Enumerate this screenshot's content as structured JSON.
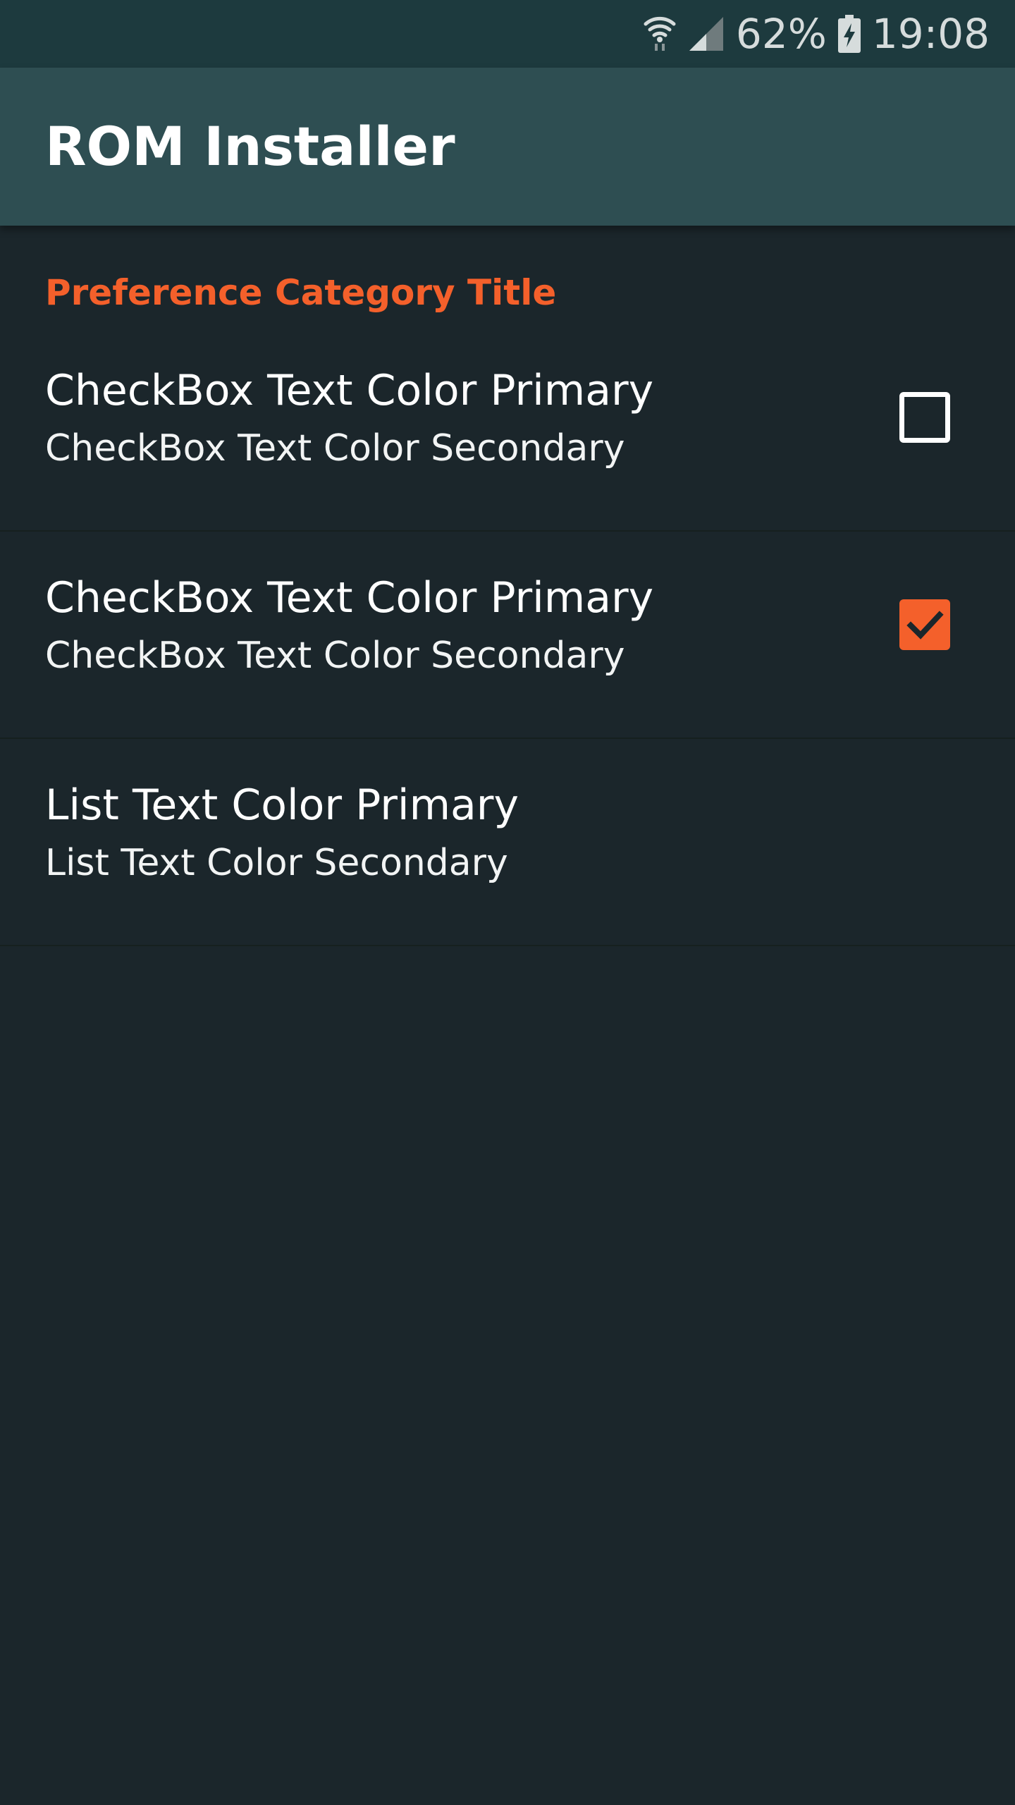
{
  "status_bar": {
    "battery_percent": "62%",
    "time": "19:08",
    "icons": [
      "wifi-icon",
      "signal-icon",
      "battery-charging-icon"
    ]
  },
  "app_bar": {
    "title": "ROM Installer"
  },
  "preferences": {
    "category_title": "Preference Category Title",
    "items": [
      {
        "type": "checkbox",
        "primary": "CheckBox Text Color Primary",
        "secondary": "CheckBox Text Color Secondary",
        "checked": false
      },
      {
        "type": "checkbox",
        "primary": "CheckBox Text Color Primary",
        "secondary": "CheckBox Text Color Secondary",
        "checked": true
      },
      {
        "type": "list",
        "primary": "List Text Color Primary",
        "secondary": "List Text Color Secondary"
      }
    ]
  },
  "colors": {
    "status_bar_bg": "#1d3a3e",
    "app_bar_bg": "#2e4e52",
    "background": "#1b262b",
    "accent": "#f4602b",
    "text_primary": "#ffffff"
  }
}
